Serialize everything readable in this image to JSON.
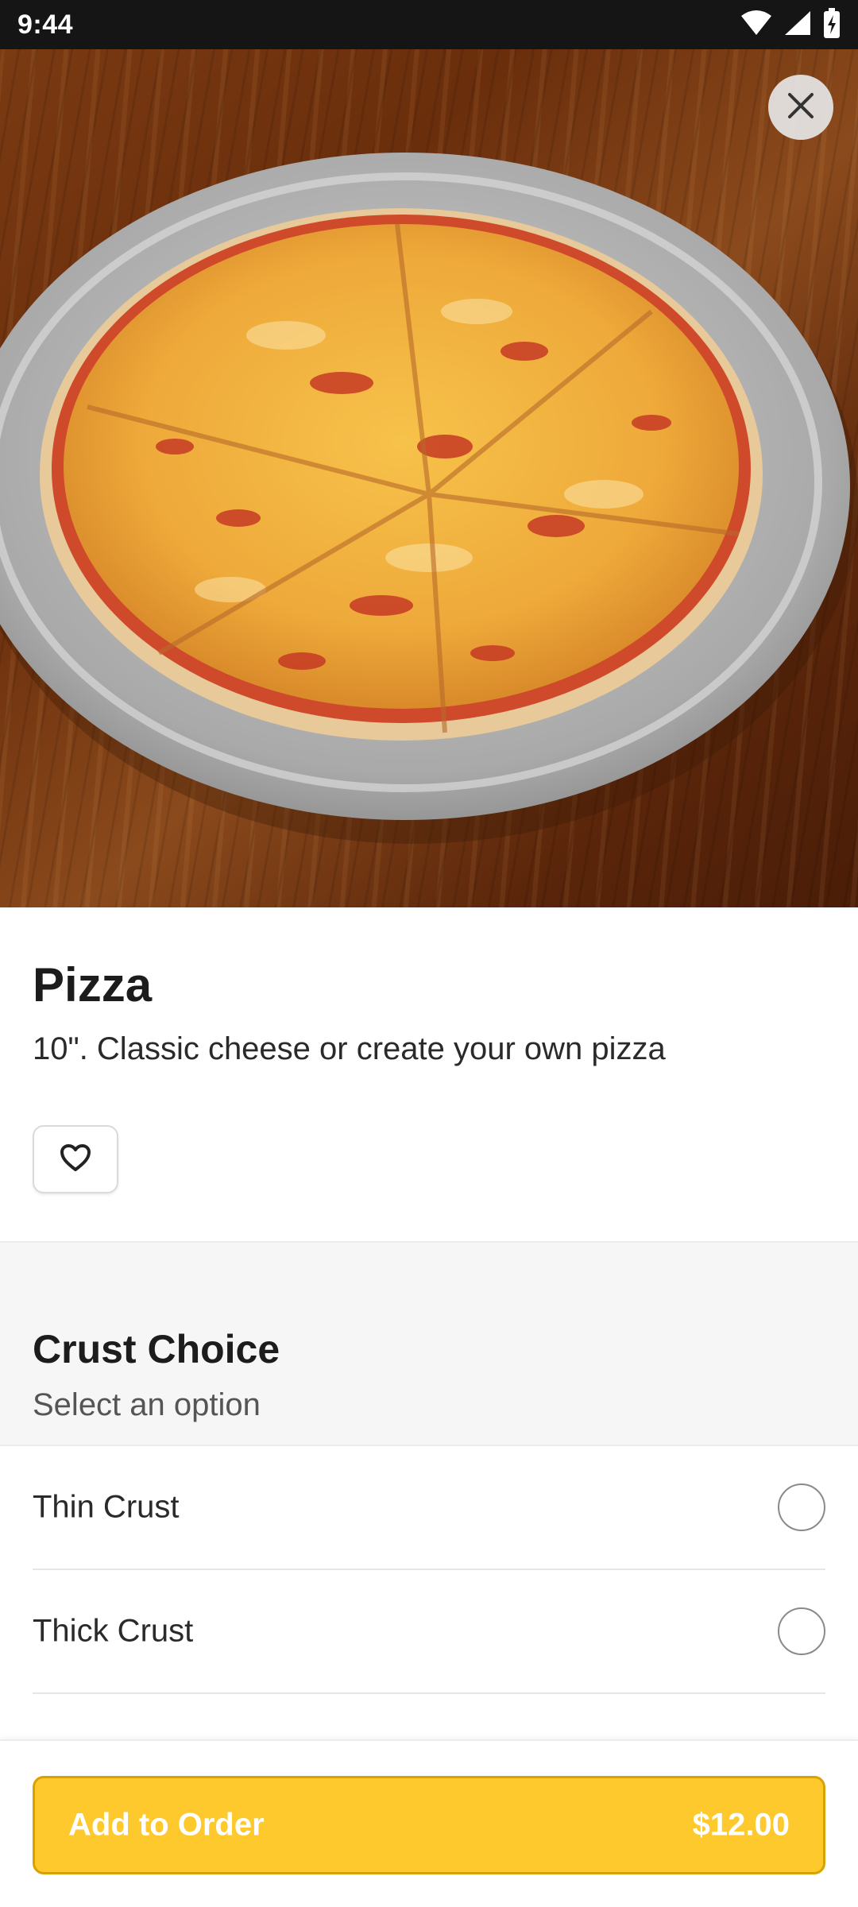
{
  "status_bar": {
    "time": "9:44",
    "icons": [
      "wifi-icon",
      "signal-icon",
      "battery-icon"
    ]
  },
  "hero": {
    "image": "pizza-photo",
    "close_icon": "close-icon"
  },
  "item": {
    "title": "Pizza",
    "description": "10\". Classic cheese or create your own pizza",
    "favorite_icon": "heart-icon"
  },
  "section": {
    "title": "Crust Choice",
    "subtitle": "Select an option",
    "options": [
      {
        "label": "Thin Crust",
        "selected": false
      },
      {
        "label": "Thick Crust",
        "selected": false
      }
    ]
  },
  "order_button": {
    "label": "Add to Order",
    "price": "$12.00"
  },
  "colors": {
    "accent": "#fdc92d",
    "accent_border": "#d8a300",
    "status_bar": "#151515",
    "section_bg": "#f6f6f6"
  }
}
